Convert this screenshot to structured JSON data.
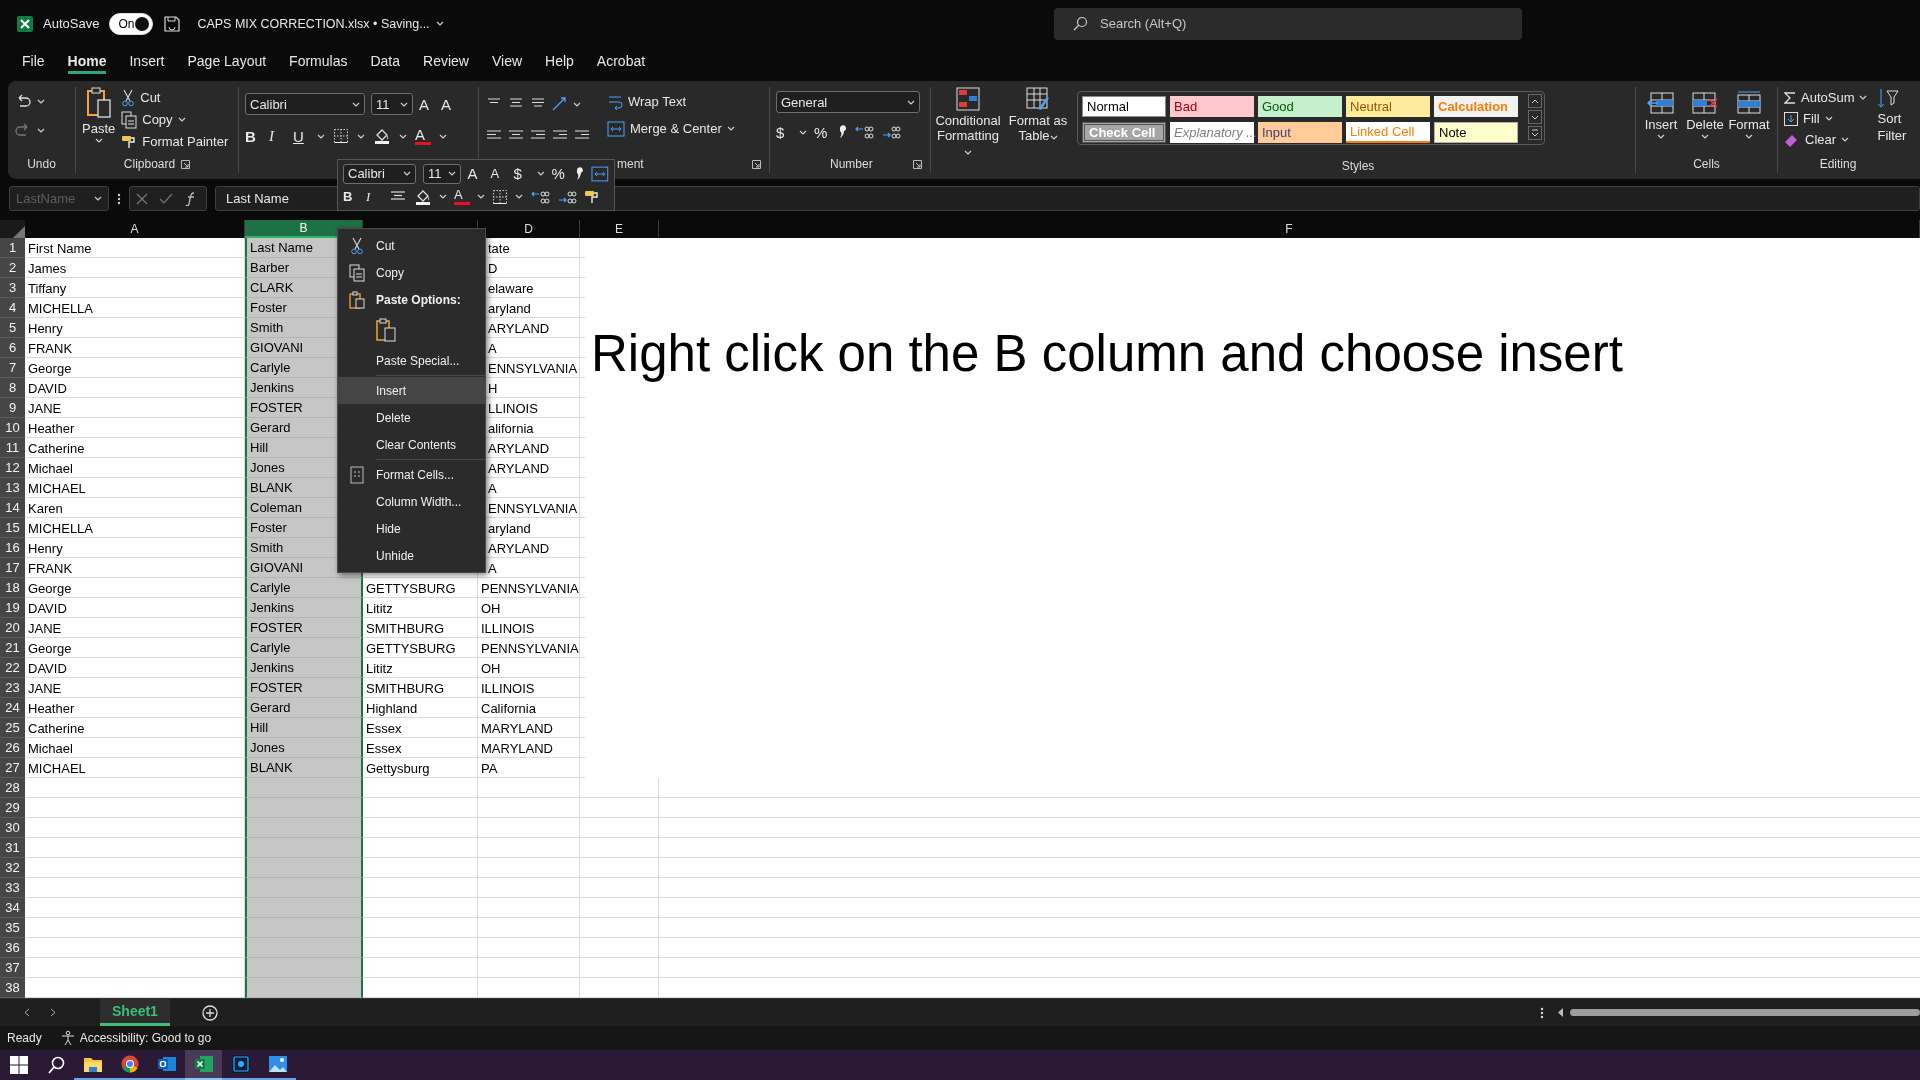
{
  "title_bar": {
    "autosave_label": "AutoSave",
    "autosave_toggle": {
      "label": "On",
      "on": true
    },
    "file_title": "CAPS MIX CORRECTION.xlsx • Saving...",
    "search": {
      "placeholder": "Search (Alt+Q)"
    }
  },
  "menu_tabs": [
    {
      "label": "File",
      "selected": false
    },
    {
      "label": "Home",
      "selected": true
    },
    {
      "label": "Insert",
      "selected": false
    },
    {
      "label": "Page Layout",
      "selected": false
    },
    {
      "label": "Formulas",
      "selected": false
    },
    {
      "label": "Data",
      "selected": false
    },
    {
      "label": "Review",
      "selected": false
    },
    {
      "label": "View",
      "selected": false
    },
    {
      "label": "Help",
      "selected": false
    },
    {
      "label": "Acrobat",
      "selected": false
    }
  ],
  "ribbon": {
    "undo": {
      "label": "Undo"
    },
    "clipboard": {
      "label": "Clipboard",
      "paste": "Paste",
      "cut": "Cut",
      "copy": "Copy",
      "format_painter": "Format Painter"
    },
    "font": {
      "name": "Calibri",
      "size": "11",
      "grow": "A",
      "shrink": "A",
      "bold": "B",
      "italic": "I",
      "underline": "U",
      "font_color": "A"
    },
    "alignment": {
      "label": "ment",
      "wrap": "Wrap Text",
      "merge": "Merge & Center"
    },
    "number": {
      "label": "Number",
      "format": "General",
      "currency": "$",
      "percent": "%"
    },
    "styles": {
      "label": "Styles",
      "conditional": "Conditional Formatting",
      "format_table": "Format as Table",
      "gallery": [
        {
          "label": "Normal",
          "kind": "normal"
        },
        {
          "label": "Bad",
          "kind": "bad"
        },
        {
          "label": "Good",
          "kind": "good"
        },
        {
          "label": "Neutral",
          "kind": "neutral"
        },
        {
          "label": "Calculation",
          "kind": "calculation"
        },
        {
          "label": "Check Cell",
          "kind": "check"
        },
        {
          "label": "Explanatory ...",
          "kind": "explanatory"
        },
        {
          "label": "Input",
          "kind": "input"
        },
        {
          "label": "Linked Cell",
          "kind": "linked"
        },
        {
          "label": "Note",
          "kind": "note"
        }
      ]
    },
    "cells": {
      "label": "Cells",
      "buttons": [
        {
          "label": "Insert",
          "kind": "insert"
        },
        {
          "label": "Delete",
          "kind": "delete"
        },
        {
          "label": "Format",
          "kind": "format"
        }
      ]
    },
    "editing": {
      "label": "Editing",
      "autosum": "AutoSum",
      "fill": "Fill",
      "clear": "Clear",
      "sort_lines": [
        "Sort",
        "Filter"
      ]
    }
  },
  "mini_toolbar": {
    "font": "Calibri",
    "size": "11",
    "grow": "A",
    "shrink": "A",
    "currency": "$",
    "percent": "%",
    "bold": "B",
    "italic": "I",
    "font_color": "A"
  },
  "formula_bar": {
    "name_box": "LastName",
    "formula": "Last Name"
  },
  "columns": [
    {
      "label": "A",
      "selected": false
    },
    {
      "label": "B",
      "selected": true
    },
    {
      "selected": false
    },
    {
      "label": "D",
      "selected": false
    },
    {
      "label": "E",
      "selected": false
    },
    {
      "label": "F",
      "selected": false
    }
  ],
  "rows": [
    {
      "number": "1",
      "a": "First Name",
      "b": "Last Name",
      "d": "tate"
    },
    {
      "number": "2",
      "a": "James",
      "b": "Barber",
      "d": "D"
    },
    {
      "number": "3",
      "a": "Tiffany",
      "b": "CLARK",
      "d": "elaware"
    },
    {
      "number": "4",
      "a": "MICHELLA",
      "b": "Foster",
      "d": "aryland"
    },
    {
      "number": "5",
      "a": "Henry",
      "b": "Smith",
      "d": "ARYLAND"
    },
    {
      "number": "6",
      "a": "FRANK",
      "b": "GIOVANI",
      "d": "A"
    },
    {
      "number": "7",
      "a": "George",
      "b": "Carlyle",
      "d": "ENNSYLVANIA"
    },
    {
      "number": "8",
      "a": "DAVID",
      "b": "Jenkins",
      "d": "H"
    },
    {
      "number": "9",
      "a": "JANE",
      "b": "FOSTER",
      "d": "LLINOIS"
    },
    {
      "number": "10",
      "a": "Heather",
      "b": "Gerard",
      "d": "alifornia"
    },
    {
      "number": "11",
      "a": "Catherine",
      "b": "Hill",
      "d": "ARYLAND"
    },
    {
      "number": "12",
      "a": "Michael",
      "b": "Jones",
      "d": "ARYLAND"
    },
    {
      "number": "13",
      "a": "MICHAEL",
      "b": "BLANK",
      "d": "A"
    },
    {
      "number": "14",
      "a": "Karen",
      "b": "Coleman",
      "d": "ENNSYLVANIA"
    },
    {
      "number": "15",
      "a": "MICHELLA",
      "b": "Foster",
      "d": "aryland"
    },
    {
      "number": "16",
      "a": "Henry",
      "b": "Smith",
      "d": "ARYLAND"
    },
    {
      "number": "17",
      "a": "FRANK",
      "b": "GIOVANI",
      "d": "A"
    },
    {
      "number": "18",
      "a": "George",
      "b": "Carlyle",
      "c": "GETTYSBURG",
      "d": "PENNSYLVANIA"
    },
    {
      "number": "19",
      "a": "DAVID",
      "b": "Jenkins",
      "c": "Lititz",
      "d": "OH"
    },
    {
      "number": "20",
      "a": "JANE",
      "b": "FOSTER",
      "c": "SMITHBURG",
      "d": "ILLINOIS"
    },
    {
      "number": "21",
      "a": "George",
      "b": "Carlyle",
      "c": "GETTYSBURG",
      "d": "PENNSYLVANIA"
    },
    {
      "number": "22",
      "a": "DAVID",
      "b": "Jenkins",
      "c": "Lititz",
      "d": "OH"
    },
    {
      "number": "23",
      "a": "JANE",
      "b": "FOSTER",
      "c": "SMITHBURG",
      "d": "ILLINOIS"
    },
    {
      "number": "24",
      "a": "Heather",
      "b": "Gerard",
      "c": "Highland",
      "d": "California"
    },
    {
      "number": "25",
      "a": "Catherine",
      "b": "Hill",
      "c": "Essex",
      "d": "MARYLAND"
    },
    {
      "number": "26",
      "a": "Michael",
      "b": "Jones",
      "c": "Essex",
      "d": "MARYLAND"
    },
    {
      "number": "27",
      "a": "MICHAEL",
      "b": "BLANK",
      "c": "Gettysburg",
      "d": "PA"
    },
    {
      "number": "28"
    },
    {
      "number": "29"
    },
    {
      "number": "30"
    },
    {
      "number": "31"
    },
    {
      "number": "32"
    },
    {
      "number": "33"
    },
    {
      "number": "34"
    },
    {
      "number": "35"
    },
    {
      "number": "36"
    },
    {
      "number": "37"
    },
    {
      "number": "38"
    }
  ],
  "annotation": "Right click on the B column and choose insert",
  "context_menu": [
    {
      "kind": "cut",
      "label": "Cut",
      "selected": false,
      "separator_before": false
    },
    {
      "kind": "copy",
      "label": "Copy",
      "selected": false,
      "separator_before": false
    },
    {
      "kind": "paste_header",
      "label": "Paste Options:",
      "selected": false,
      "separator_before": false
    },
    {
      "kind": "paste_option",
      "selected": false,
      "separator_before": false
    },
    {
      "kind": "plain",
      "label": "Paste Special...",
      "selected": false,
      "separator_before": false
    },
    {
      "kind": "plain",
      "label": "Insert",
      "selected": true,
      "separator_before": true
    },
    {
      "kind": "plain",
      "label": "Delete",
      "selected": false,
      "separator_before": false
    },
    {
      "kind": "plain",
      "label": "Clear Contents",
      "selected": false,
      "separator_before": false
    },
    {
      "kind": "format_cells",
      "label": "Format Cells...",
      "selected": false,
      "separator_before": true
    },
    {
      "kind": "plain",
      "label": "Column Width...",
      "selected": false,
      "separator_before": false
    },
    {
      "kind": "plain",
      "label": "Hide",
      "selected": false,
      "separator_before": false
    },
    {
      "kind": "plain",
      "label": "Unhide",
      "selected": false,
      "separator_before": false
    }
  ],
  "sheet_tabs": [
    {
      "label": "Sheet1",
      "selected": true
    }
  ],
  "status_bar": {
    "ready": "Ready",
    "accessibility": "Accessibility: Good to go"
  },
  "taskbar": [
    {
      "kind": "start",
      "selected": false,
      "running": false
    },
    {
      "kind": "search",
      "selected": false,
      "running": false
    },
    {
      "kind": "explorer",
      "selected": false,
      "running": true
    },
    {
      "kind": "browser",
      "selected": false,
      "running": true
    },
    {
      "kind": "mail",
      "selected": false,
      "running": true
    },
    {
      "kind": "sheet",
      "selected": true,
      "running": true
    },
    {
      "kind": "photo_editor",
      "selected": false,
      "running": true
    },
    {
      "kind": "photos",
      "selected": false,
      "running": true
    }
  ]
}
